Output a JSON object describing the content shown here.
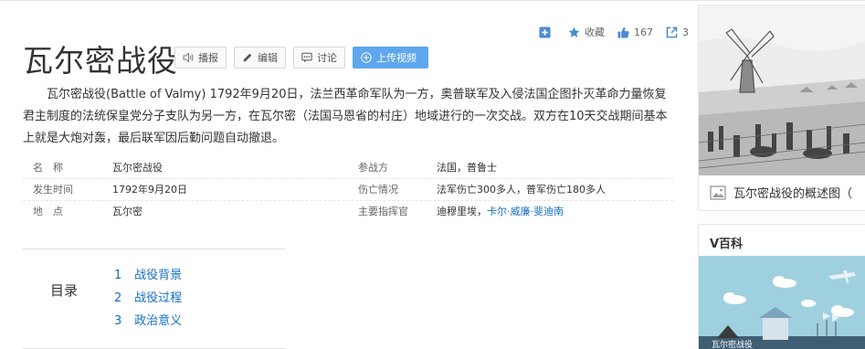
{
  "actions": {
    "add_label": "",
    "favorite_label": "收藏",
    "like_count": "167",
    "share_count": "3"
  },
  "title": "瓦尔密战役",
  "buttons": {
    "report": "播报",
    "edit": "编辑",
    "discuss": "讨论",
    "upload_video": "上传视频"
  },
  "summary": "瓦尔密战役(Battle of Valmy) 1792年9月20日，法兰西革命军队为一方，奥普联军及入侵法国企图扑灭革命力量恢复君主制度的法统保皇党分子支队为另一方，在瓦尔密（法国马恩省的村庄）地域进行的一次交战。双方在10天交战期间基本上就是大炮对轰，最后联军因后勤问题自动撤退。",
  "info": {
    "rows": [
      {
        "k1": "名　称",
        "v1": "瓦尔密战役",
        "k2": "参战方",
        "v2": "法国，普鲁士"
      },
      {
        "k1": "发生时间",
        "v1": "1792年9月20日",
        "k2": "伤亡情况",
        "v2": "法军伤亡300多人，普军伤亡180多人"
      },
      {
        "k1": "地　点",
        "v1": "瓦尔密",
        "k2": "主要指挥官",
        "v2_plain": "迪穆里埃，",
        "v2_link": "卡尔·威廉·斐迪南"
      }
    ]
  },
  "toc": {
    "label": "目录",
    "items": [
      {
        "num": "1",
        "text": "战役背景"
      },
      {
        "num": "2",
        "text": "战役过程"
      },
      {
        "num": "3",
        "text": "政治意义"
      }
    ]
  },
  "sidebar": {
    "image_caption": "瓦尔密战役的概述图（",
    "vbaike_title": "V百科",
    "video_overlay": "瓦尔密战役",
    "icons": [
      "plus-square-icon",
      "star-icon",
      "thumbs-up-icon",
      "share-icon",
      "picture-icon"
    ]
  },
  "colors": {
    "link": "#136ec2",
    "upload_button": "#5ea7ee",
    "icon_blue": "#4c8ad6",
    "video_sky": "#9fd0e0"
  }
}
